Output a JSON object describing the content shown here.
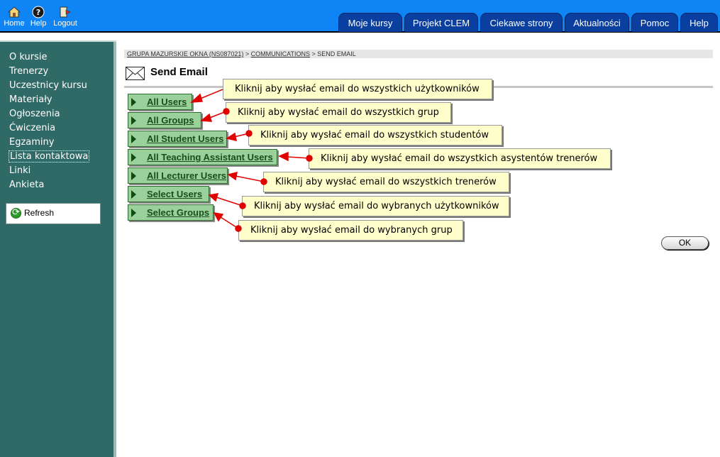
{
  "topbar": {
    "icons": [
      {
        "label": "Home",
        "icon": "home-icon"
      },
      {
        "label": "Help",
        "icon": "help-icon"
      },
      {
        "label": "Logout",
        "icon": "logout-icon"
      }
    ],
    "tabs": [
      "Moje kursy",
      "Projekt CLEM",
      "Ciekawe strony",
      "Aktualności",
      "Pomoc",
      "Help"
    ],
    "colors": {
      "bar": "#0f84f5",
      "tab": "#0a3fa0"
    }
  },
  "sidebar": {
    "items": [
      "O kursie",
      "Trenerzy",
      "Uczestnicy kursu",
      "Materiały",
      "Ogłoszenia",
      "Ćwiczenia",
      "Egzaminy",
      "Lista kontaktowa",
      "Linki",
      "Ankieta"
    ],
    "active": "Lista kontaktowa",
    "refresh_label": "Refresh",
    "colors": {
      "background": "#2f6a67"
    }
  },
  "breadcrumb": {
    "items": [
      "GRUPA MAZURSKIE OKNA (NS087021)",
      "COMMUNICATIONS",
      "SEND EMAIL"
    ],
    "separator": " > "
  },
  "page": {
    "title": "Send Email",
    "title_icon": "envelope-icon",
    "buttons": [
      "All Users",
      "All Groups",
      "All Student Users",
      "All Teaching Assistant Users",
      "All Lecturer Users",
      "Select Users",
      "Select Groups"
    ],
    "callouts": [
      "Kliknij aby wysłać email do wszystkich użytkowników",
      "Kliknij aby wysłać email do wszystkich grup",
      "Kliknij aby wysłać email do wszystkich studentów",
      "Kliknij aby wysłać email do wszystkich asystentów trenerów",
      "Kliknij aby wysłać email do wszystkich trenerów",
      "Kliknij aby wysłać email do wybranych użytkowników",
      "Kliknij aby wysłać email do wybranych grup"
    ],
    "ok_label": "OK",
    "colors": {
      "button": "#9ad09a",
      "callout": "#ffffcc",
      "arrow": "#e00000"
    }
  }
}
